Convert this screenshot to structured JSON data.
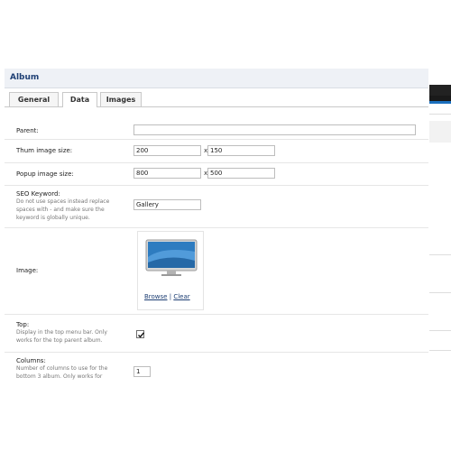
{
  "header": {
    "title": "Album"
  },
  "tabs": [
    {
      "label": "General"
    },
    {
      "label": "Data"
    },
    {
      "label": "Images"
    }
  ],
  "active_tab": "Data",
  "form": {
    "parent": {
      "label": "Parent:",
      "value": ""
    },
    "thumb_size": {
      "label": "Thum image size:",
      "width": "200",
      "x": "x",
      "height": "150"
    },
    "popup_size": {
      "label": "Popup image size:",
      "width": "800",
      "x": "x",
      "height": "500"
    },
    "seo": {
      "label": "SEO Keyword:",
      "hint_lines": [
        "Do not use spaces instead replace",
        "spaces with - and make sure the",
        "keyword is globally unique."
      ],
      "value": "Gallery"
    },
    "image": {
      "label": "Image:",
      "icon": "monitor-image",
      "browse": "Browse",
      "separator": "|",
      "clear": "Clear"
    },
    "top": {
      "label": "Top:",
      "hint_lines": [
        "Display in the top menu bar. Only",
        "works for the top parent album."
      ],
      "checked": true
    },
    "columns": {
      "label": "Columns:",
      "hint_lines": [
        "Number of columns to use for the",
        "bottom 3 album. Only works for"
      ],
      "value": "1"
    }
  },
  "colors": {
    "title": "#1e3f74",
    "header_bg": "#eef1f6",
    "link": "#1e3f74",
    "accent_blue": "#1b6fbd"
  }
}
